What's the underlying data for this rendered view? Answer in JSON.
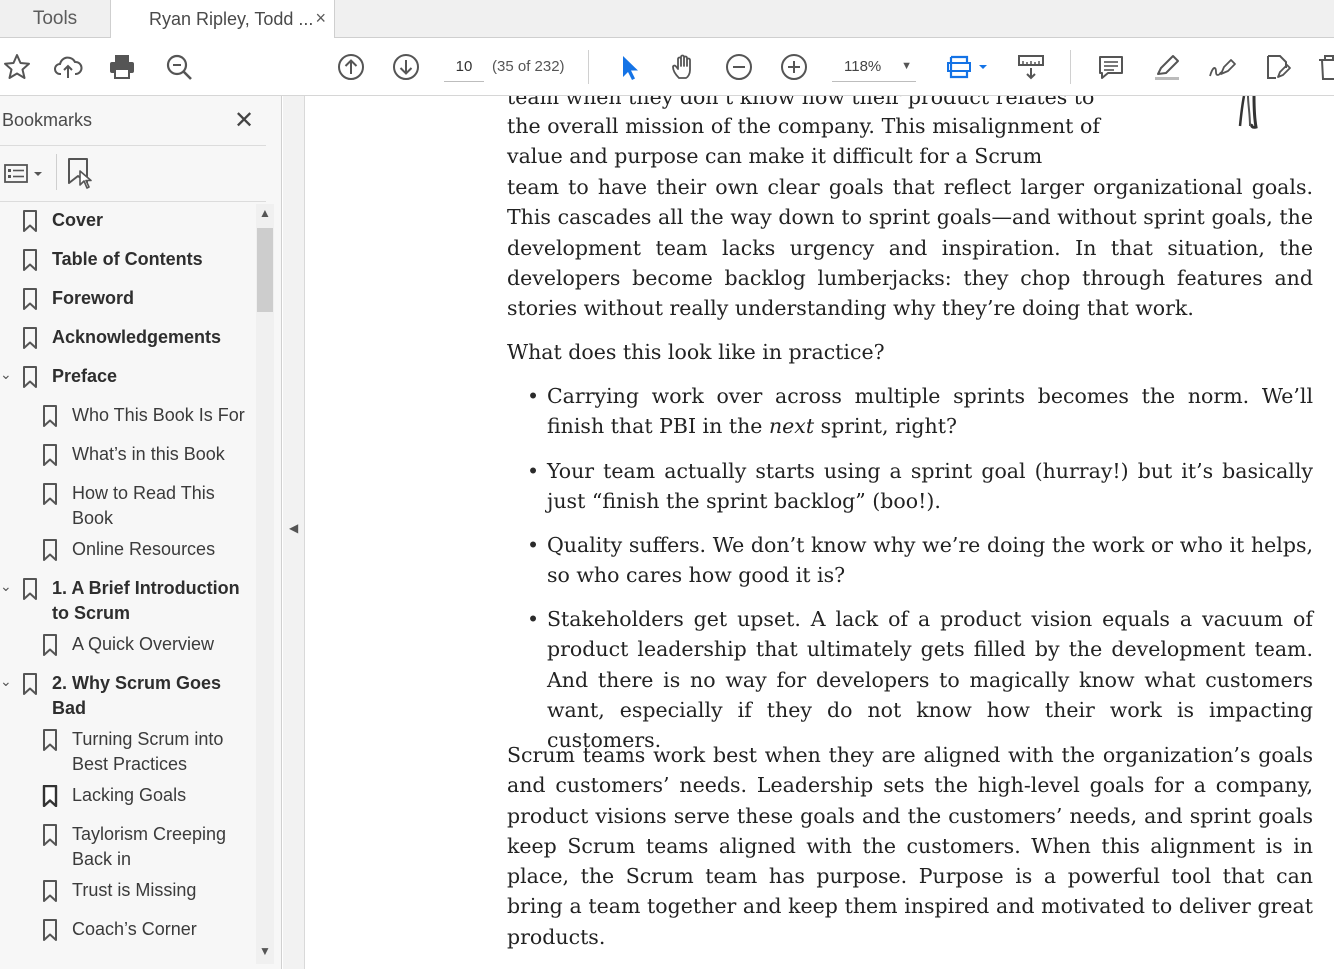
{
  "tabs": {
    "tools_label": "Tools",
    "doc_label": "Ryan Ripley, Todd ...",
    "close_label": "×"
  },
  "toolbar": {
    "page_number": "10",
    "page_count": "(35 of 232)",
    "zoom": "118%"
  },
  "bookmarks": {
    "title": "Bookmarks",
    "close_label": "✕",
    "items": [
      {
        "label": "Cover"
      },
      {
        "label": "Table of Contents"
      },
      {
        "label": "Foreword"
      },
      {
        "label": "Acknowledgements"
      },
      {
        "label": "Preface"
      },
      {
        "label": "Who This Book Is For"
      },
      {
        "label": "What’s in this Book"
      },
      {
        "label": "How to Read This Book"
      },
      {
        "label": "Online Resources"
      },
      {
        "label": "1. A Brief Introduction to Scrum"
      },
      {
        "label": "A Quick Overview"
      },
      {
        "label": "2. Why Scrum Goes Bad"
      },
      {
        "label": "Turning Scrum into Best Practices"
      },
      {
        "label": "Lacking Goals"
      },
      {
        "label": "Taylorism Creeping Back in"
      },
      {
        "label": "Trust is Missing"
      },
      {
        "label": "Coach’s Corner"
      }
    ]
  },
  "document": {
    "clipped_line": "team when they don’t know how their product relates to",
    "para1_narrow": "the overall mission of the company. This misalignment of value and purpose can make it difficult for a Scrum",
    "para1_wide": "team to have their own clear goals that reflect larger organizational goals. This cascades all the way down to sprint goals—and without sprint goals, the development team lacks urgency and inspiration. In that situation, the developers become backlog lumberjacks: they chop through features and stories without really understanding why they’re doing that work.",
    "question": "What does this look like in practice?",
    "bullet1_pre": "Carrying work over across multiple sprints becomes the norm. We’ll finish that PBI in the ",
    "bullet1_em": "next",
    "bullet1_post": " sprint, right?",
    "bullet2": "Your team actually starts using a sprint goal (hurray!) but it’s basically just “finish the sprint backlog” (boo!).",
    "bullet3": "Quality suffers. We don’t know why we’re doing the work or who it helps, so who cares how good it is?",
    "bullet4": "Stakeholders get upset. A lack of a product vision equals a vacuum of product leadership that ultimately gets filled by the development team. And there is no way for developers to magically know what customers want, especially if they do not know how their work is impacting customers.",
    "para_final": "Scrum teams work best when they are aligned with the organization’s goals and customers’ needs. Leadership sets the high-level goals for a company, product visions serve these goals and the customers’ needs, and sprint goals keep Scrum teams aligned with the customers. When this alignment is in place, the Scrum team has purpose. Purpose is a powerful tool that can bring a team together and keep them inspired and motivated to deliver great products."
  },
  "colors": {
    "accent": "#1473e6",
    "icon": "#555555"
  }
}
